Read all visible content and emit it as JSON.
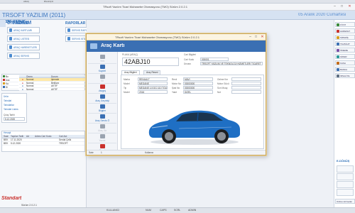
{
  "window": {
    "title": "TRsoft Yazılım Ticari Muhasebe Otomasyonu (TMO) Sürüm 2.0.2.1",
    "toolbar_items": [
      "ARAÇ",
      "BİLANÇO"
    ]
  },
  "header": {
    "title": "TRSOFT YAZILIM (2011)",
    "date": "05 Aralık 2020 Cumartesi"
  },
  "brand": {
    "fragment": "OFT YAZILIM"
  },
  "left": {
    "section_oto": "OTO SERVİS",
    "section_raporlar": "RAPORLAR",
    "oto_tiles": [
      "ARAÇ KARTLARI",
      "ARAÇ LİSTESİ",
      "ARAÇ HAREKETLERİ",
      "ARAÇ SERVİS"
    ],
    "rapor_tiles": [
      "SERVİS RAPORLARI",
      "SERVİS İSTATİSTİK"
    ],
    "tree": [
      {
        "label": "Bu",
        "color": "#3a8a3a"
      },
      {
        "label": "Ana",
        "color": "#c9302c"
      },
      {
        "label": "Ka",
        "color": "#d8a020"
      },
      {
        "label": "Di",
        "color": "#3a6fb3"
      }
    ],
    "task_headers": [
      "Önem",
      "Durum"
    ],
    "tasks": [
      {
        "prio": "Normal",
        "status": "İşlemde",
        "selected": true
      },
      {
        "prio": "Normal",
        "status": "Bekliyor",
        "selected": false
      },
      {
        "prio": "Normal",
        "status": "AKTİF",
        "selected": false
      },
      {
        "prio": "Normal",
        "status": "AKTİF",
        "selected": false
      }
    ],
    "menu": [
      "Ürün",
      "Tahsilat",
      "Tahsilatlar",
      "Tahsilat Listesi"
    ],
    "date_label": "Çıkış Tarihi",
    "date_value": "5.12.2020",
    "table_title": "Hesapl",
    "table_headers": [
      "Saat",
      "Yapılan Tarih",
      "Ad",
      "Adres Cari Kodu",
      "Cari Adı"
    ],
    "table_rows": [
      [
        "BEK",
        "17.11.2020",
        "",
        "",
        "Serdal Çelik"
      ],
      [
        "BEK",
        "5.12.2020",
        "",
        "",
        "TRSOFT"
      ]
    ],
    "bottom_brand": "Standart",
    "bottom_version": "Sürüm 2.0.2.1"
  },
  "right": {
    "buttons": [
      "FİYAT",
      "HAREKET",
      "SİPARİŞ",
      "TAHSİLAT",
      "ÖDEME",
      "GİDER",
      "KASA",
      "BANKA",
      "İRSALİYE"
    ],
    "button_colors": [
      "#3a8a3a",
      "#c9302c",
      "#d8a020",
      "#3a6fb3",
      "#7a4fa8",
      "#2a9a9a",
      "#c26b1a",
      "#3a6fb3",
      "#5c6c80"
    ],
    "section_label": "E-DÖNÜŞ",
    "bottom_button": "Online Hizmetler"
  },
  "status": {
    "items": [
      "KULLANICI",
      "NUM",
      "CAPS",
      "SCRL",
      "ADMIN"
    ]
  },
  "dialog": {
    "title": "TRsoft Yazılım Ticari Muhasebe Otomasyonu (TMO) Sürüm 2.0.2.1",
    "heading": "Araç Kartı",
    "sidebar": [
      {
        "label": "Yeni",
        "icon": "#9aa3b0",
        "enabled": false
      },
      {
        "label": "Kaydet",
        "icon": "#3a6fb3",
        "enabled": true
      },
      {
        "label": "Sil",
        "icon": "#9aa3b0",
        "enabled": false
      },
      {
        "label": "Vazgeç",
        "icon": "#c9302c",
        "enabled": true
      },
      {
        "label": "Araç Geçmişi",
        "icon": "#3a6fb3",
        "enabled": true
      },
      {
        "label": "Bilgiler",
        "icon": "#3a6fb3",
        "enabled": true
      },
      {
        "label": "Araç Servis Ö",
        "icon": "#3a6fb3",
        "enabled": true
      },
      {
        "label": "Araç Sa",
        "icon": "#9aa3b0",
        "enabled": false
      },
      {
        "label": "Yazdır",
        "icon": "#9aa3b0",
        "enabled": false
      },
      {
        "label": "Kapat",
        "icon": "#c9302c",
        "enabled": true
      }
    ],
    "plate_label": "PLAKA (ARAÇ)",
    "plate_value": "42ABJ10",
    "cari_label": "Cari Bilgileri",
    "cari_code_label": "Cari Kodu",
    "cari_code": "000001",
    "cari_name_label": "Ünvanı",
    "cari_name": "TRSOFT YAZILIM VE TEKNOLOJİ HİZMETLERİ TİCARET",
    "tabs": [
      "Araç Bilgileri",
      "Araç Resmi"
    ],
    "fields_left": [
      {
        "label": "Marka",
        "value": "RENAULT"
      },
      {
        "label": "Model",
        "value": "MEGANE"
      },
      {
        "label": "Tip",
        "value": "MEGANE 1.5 DCİ 110 TOU"
      },
      {
        "label": "Model",
        "value": "2016"
      }
    ],
    "fields_mid": [
      {
        "label": "Renk",
        "value": "MAVİ"
      },
      {
        "label": "Motor No",
        "value": "00000000"
      },
      {
        "label": "Şasi No",
        "value": "00000000"
      },
      {
        "label": "Yakıt",
        "value": "DİZEL"
      }
    ],
    "fields_right": [
      {
        "label": "Gelme Km",
        "value": ""
      },
      {
        "label": "Motor Gücü",
        "value": ""
      },
      {
        "label": "Son Muay.",
        "value": ""
      },
      {
        "label": "Not",
        "value": ""
      }
    ],
    "status_left": "Satır",
    "status_count": "1",
    "status_right": "Kullanıcı"
  },
  "colors": {
    "accent": "#3a6fb3",
    "car_body": "#1f6fc4"
  }
}
